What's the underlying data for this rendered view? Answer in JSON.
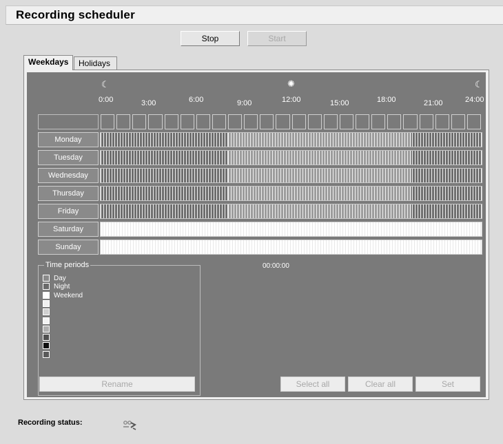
{
  "title": "Recording scheduler",
  "controls": {
    "stop": "Stop",
    "start": "Start"
  },
  "tabs": [
    {
      "label": "Weekdays",
      "active": true
    },
    {
      "label": "Holidays",
      "active": false
    }
  ],
  "timeline": {
    "icons": [
      "moon-icon",
      "sun-icon",
      "moon-icon"
    ],
    "marks": [
      "0:00",
      "3:00",
      "6:00",
      "9:00",
      "12:00",
      "15:00",
      "18:00",
      "21:00",
      "24:00"
    ]
  },
  "days": [
    {
      "label": "Monday",
      "period": "Day"
    },
    {
      "label": "Tuesday",
      "period": "Day"
    },
    {
      "label": "Wednesday",
      "period": "Day"
    },
    {
      "label": "Thursday",
      "period": "Day"
    },
    {
      "label": "Friday",
      "period": "Day"
    },
    {
      "label": "Saturday",
      "period": "Weekend"
    },
    {
      "label": "Sunday",
      "period": "Weekend"
    }
  ],
  "legend": {
    "title": "Time periods",
    "items": [
      {
        "label": "Day",
        "color": "#8a8a8a"
      },
      {
        "label": "Night",
        "color": "#6a6a6a"
      },
      {
        "label": "Weekend",
        "color": "#ffffff"
      },
      {
        "label": "",
        "color": "#f0f0f0"
      },
      {
        "label": "",
        "color": "#d0d0d0"
      },
      {
        "label": "",
        "color": "#f4f4f4"
      },
      {
        "label": "",
        "color": "#b0b0b0"
      },
      {
        "label": "",
        "color": "#505050"
      },
      {
        "label": "",
        "color": "#101010"
      },
      {
        "label": "",
        "color": "#5a5a5a"
      }
    ]
  },
  "selected_time": "00:00:00",
  "buttons": {
    "rename": "Rename",
    "select_all": "Select all",
    "clear_all": "Clear all",
    "set": "Set"
  },
  "status": {
    "label": "Recording status:",
    "icon": "recording-status-icon"
  },
  "colors": {
    "panel_bg": "#7a7a7a",
    "page_bg": "#dcdcdc"
  }
}
